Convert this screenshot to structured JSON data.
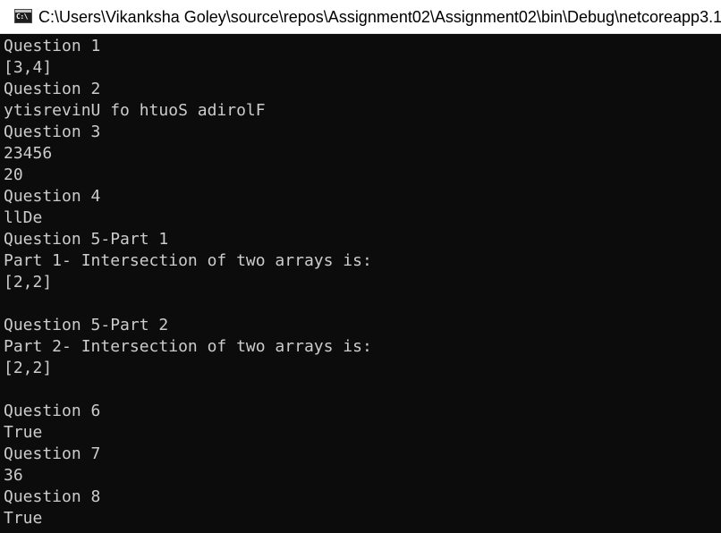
{
  "window": {
    "icon": "console-app-icon",
    "icon_glyph": "C:\\",
    "title": "C:\\Users\\Vikanksha Goley\\source\\repos\\Assignment02\\Assignment02\\bin\\Debug\\netcoreapp3.1"
  },
  "console": {
    "lines": [
      "Question 1",
      "[3,4]",
      "Question 2",
      "ytisrevinU fo htuoS adirolF",
      "Question 3",
      "23456",
      "20",
      "Question 4",
      "llDe",
      "Question 5-Part 1",
      "Part 1- Intersection of two arrays is:",
      "[2,2]",
      "",
      "Question 5-Part 2",
      "Part 2- Intersection of two arrays is:",
      "[2,2]",
      "",
      "Question 6",
      "True",
      "Question 7",
      "36",
      "Question 8",
      "True"
    ]
  }
}
